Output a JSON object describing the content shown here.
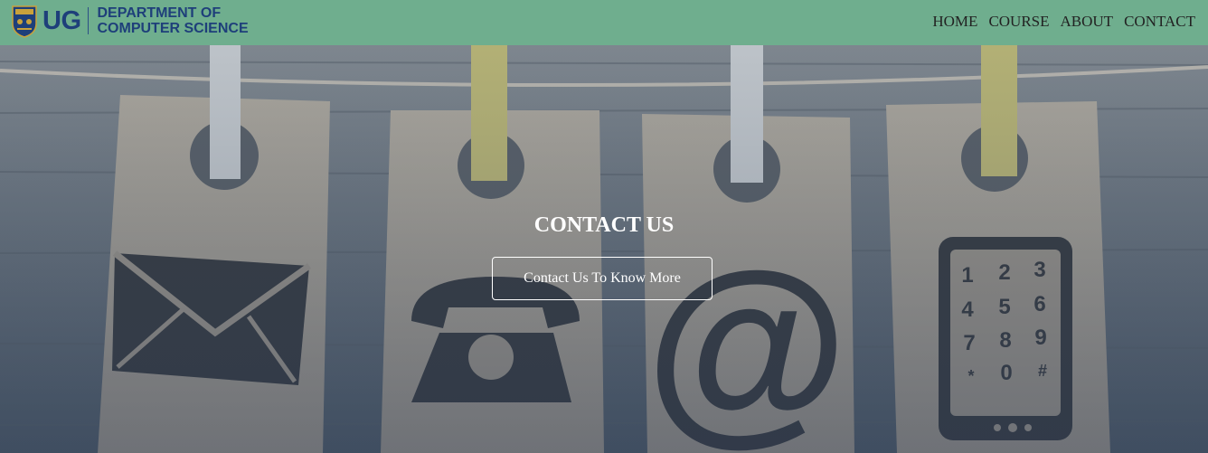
{
  "brand": {
    "abbrev": "UG",
    "department_line1": "DEPARTMENT OF",
    "department_line2": "COMPUTER SCIENCE",
    "crest_icon": "university-crest-icon"
  },
  "nav": {
    "items": [
      {
        "label": "HOME"
      },
      {
        "label": "COURSE"
      },
      {
        "label": "ABOUT"
      },
      {
        "label": "CONTACT"
      }
    ]
  },
  "hero": {
    "title": "CONTACT US",
    "button_label": "Contact Us To Know More",
    "background_image": "contact-tags-on-clothesline",
    "tags": {
      "envelope_icon": "envelope-icon",
      "phone_icon": "telephone-icon",
      "at_icon": "at-sign-icon",
      "keypad_icon": "mobile-phone-icon",
      "keypad_keys": [
        "1",
        "2",
        "3",
        "4",
        "5",
        "6",
        "7",
        "8",
        "9",
        "*",
        "0",
        "#"
      ]
    }
  },
  "colors": {
    "navbar": "#6fae8e",
    "brand_blue": "#1e3f7a",
    "overlay_tint": "#3a4a5a"
  }
}
